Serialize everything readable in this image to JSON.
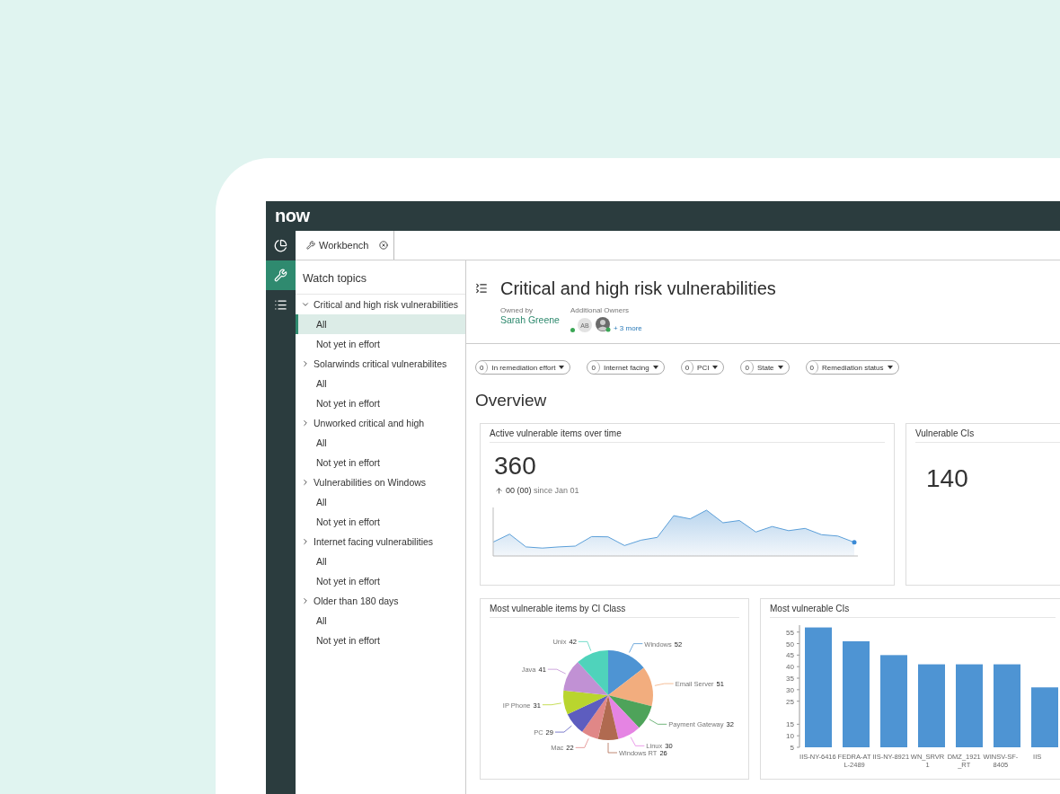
{
  "brand": {
    "logo": "now"
  },
  "rail": [
    {
      "selected": false
    },
    {
      "selected": true
    },
    {
      "selected": false
    }
  ],
  "tabs": [
    {
      "label": "Workbench",
      "selected": true
    }
  ],
  "sidebar": {
    "title": "Watch topics",
    "groups": [
      {
        "label": "Critical and high risk vulnerabilities",
        "expanded": true,
        "children": [
          {
            "label": "All",
            "selected": true
          },
          {
            "label": "Not yet in effort",
            "selected": false
          }
        ]
      },
      {
        "label": "Solarwinds critical vulnerabilites",
        "expanded": false,
        "children": [
          {
            "label": "All",
            "selected": false
          },
          {
            "label": "Not yet in effort",
            "selected": false
          }
        ]
      },
      {
        "label": "Unworked critical and high",
        "expanded": false,
        "children": [
          {
            "label": "All",
            "selected": false
          },
          {
            "label": "Not yet in effort",
            "selected": false
          }
        ]
      },
      {
        "label": "Vulnerabilities on Windows",
        "expanded": false,
        "children": [
          {
            "label": "All",
            "selected": false
          },
          {
            "label": "Not yet in effort",
            "selected": false
          }
        ]
      },
      {
        "label": "Internet facing vulnerabilities",
        "expanded": false,
        "children": [
          {
            "label": "All",
            "selected": false
          },
          {
            "label": "Not yet in effort",
            "selected": false
          }
        ]
      },
      {
        "label": "Older than 180 days",
        "expanded": false,
        "children": [
          {
            "label": "All",
            "selected": false
          },
          {
            "label": "Not yet in effort",
            "selected": false
          }
        ]
      }
    ]
  },
  "header": {
    "title": "Critical and high risk vulnerabilities",
    "owned_by_label": "Owned by",
    "owner": "Sarah Greene",
    "additional_owners_label": "Additional Owners",
    "owners": [
      {
        "kind": "initials",
        "text": "AB"
      },
      {
        "kind": "photo"
      }
    ],
    "more": "+ 3 more"
  },
  "filters": [
    {
      "count": "0",
      "label": "In remediation effort"
    },
    {
      "count": "0",
      "label": "Internet facing"
    },
    {
      "count": "0",
      "label": "PCI"
    },
    {
      "count": "0",
      "label": "State"
    },
    {
      "count": "0",
      "label": "Remediation status"
    }
  ],
  "section_title": "Overview",
  "cards": [
    {
      "kind": "trend",
      "title": "Active vulnerable items over time",
      "value": "360",
      "delta": "00 (00)",
      "delta_note": "since Jan 01"
    },
    {
      "kind": "number",
      "title": "Vulnerable CIs",
      "value": "140"
    },
    {
      "kind": "chart",
      "title": "Most vulnerable items by CI Class",
      "chart_data": {
        "type": "pie",
        "categories": [
          "Windows",
          "Email Server",
          "Payment Gateway",
          "Linux",
          "Windows RT",
          "Mac",
          "PC",
          "IP Phone",
          "Java",
          "Unix"
        ],
        "series": [
          {
            "values": [
              52,
              51,
              32,
              30,
              26,
              22,
              29,
              31,
              41,
              42
            ]
          }
        ],
        "colors": [
          "#4e94d3",
          "#f2ad7e",
          "#4ea35a",
          "#e584e3",
          "#b06a50",
          "#e08787",
          "#5d5dbf",
          "#b9d52e",
          "#c191d4",
          "#4fd3bb"
        ],
        "data_labels": true
      }
    },
    {
      "kind": "chart",
      "title": "Most vulnerable CIs",
      "chart_data": {
        "type": "bar",
        "categories": [
          "IIS-NY-6416",
          "FEDRA-ATL-2489",
          "IIS-NY-8921",
          "WN_SRVR1",
          "DMZ_1921_RT",
          "WINSV-SF-8405",
          "IIS"
        ],
        "series": [
          {
            "color": "#4e94d3",
            "values": [
              57,
              51,
              45,
              41,
              41,
              41,
              31
            ]
          }
        ],
        "ylim": [
          5,
          58
        ],
        "yticks": [
          5,
          10,
          15,
          25,
          30,
          35,
          40,
          45,
          50,
          55
        ]
      }
    }
  ]
}
